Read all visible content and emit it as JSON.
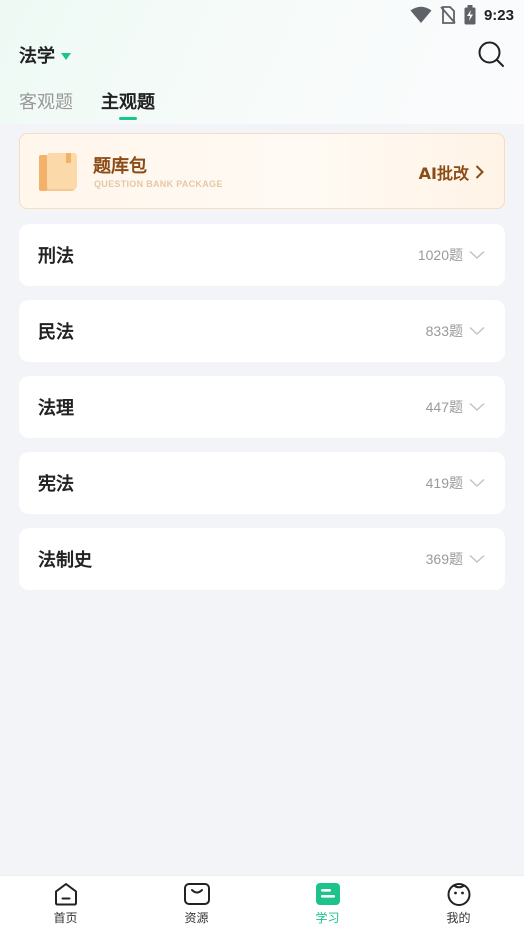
{
  "status_bar": {
    "time": "9:23"
  },
  "header": {
    "subject": "法学"
  },
  "tabs": [
    {
      "label": "客观题",
      "active": false
    },
    {
      "label": "主观题",
      "active": true
    }
  ],
  "banner": {
    "title": "题库包",
    "subtitle": "QUESTION BANK PACKAGE",
    "link_label": "AI批改"
  },
  "subjects": [
    {
      "name": "刑法",
      "count": "1020题"
    },
    {
      "name": "民法",
      "count": "833题"
    },
    {
      "name": "法理",
      "count": "447题"
    },
    {
      "name": "宪法",
      "count": "419题"
    },
    {
      "name": "法制史",
      "count": "369题"
    }
  ],
  "bottom_nav": [
    {
      "label": "首页",
      "icon": "home-icon",
      "active": false
    },
    {
      "label": "资源",
      "icon": "bag-icon",
      "active": false
    },
    {
      "label": "学习",
      "icon": "study-icon",
      "active": true
    },
    {
      "label": "我的",
      "icon": "profile-icon",
      "active": false
    }
  ],
  "colors": {
    "accent": "#1dc38a",
    "banner_text": "#8b4c15"
  }
}
